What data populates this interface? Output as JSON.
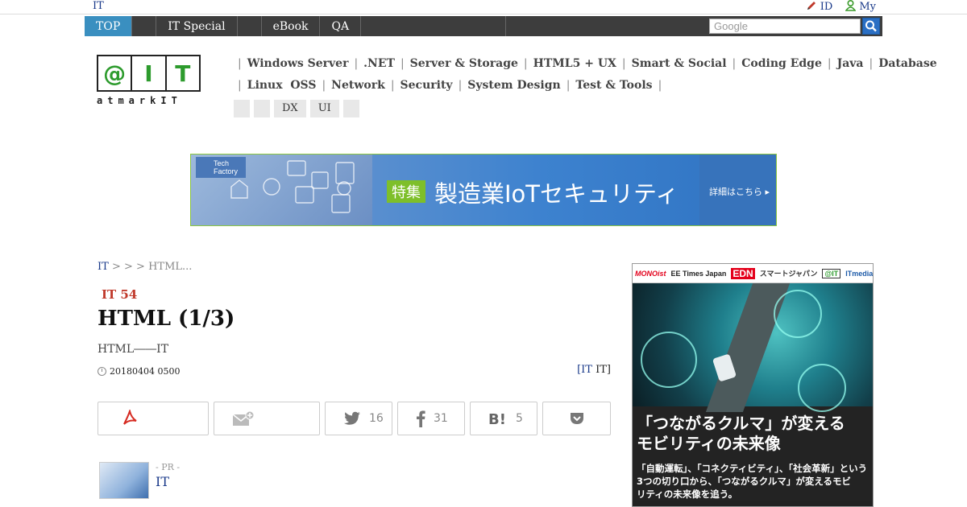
{
  "topbar": {
    "site_label": "IT",
    "id_label": "ID",
    "my_label": "My"
  },
  "nav": {
    "items": [
      {
        "label": "TOP",
        "active": true
      },
      {
        "label": ""
      },
      {
        "label": "IT Special"
      },
      {
        "label": ""
      },
      {
        "label": "eBook"
      },
      {
        "label": "QA"
      },
      {
        "label": ""
      }
    ],
    "search_placeholder": "Google"
  },
  "logo": {
    "letters": [
      "@",
      "I",
      "T"
    ],
    "wordmark": "atmarkIT"
  },
  "categories": {
    "row1": [
      "Windows Server",
      ".NET",
      "Server & Storage",
      "HTML5 + UX",
      "Smart & Social",
      "Coding Edge",
      "Java",
      "Database"
    ],
    "row2": [
      "Linux  OSS",
      "Network",
      "Security",
      "System Design",
      "Test & Tools"
    ],
    "chips": [
      "",
      "",
      "DX",
      "UI",
      ""
    ]
  },
  "banner": {
    "badge": "Tech Factory",
    "tag": "特集",
    "title": "製造業IoTセキュリティ",
    "more": "詳細はこちら ▸"
  },
  "article": {
    "breadcrumb": [
      "IT",
      ">",
      ">",
      "> HTML..."
    ],
    "series": "IT 54",
    "title": "HTML (1/3)",
    "subtitle": "HTML――IT",
    "date": "20180404 0500",
    "author_link": "[IT",
    "author_rest": "IT]"
  },
  "share": {
    "twitter_count": "16",
    "facebook_count": "31",
    "hatena_count": "5"
  },
  "pr": {
    "tag": "- PR -",
    "title": "IT"
  },
  "sidead": {
    "logos": [
      "MONOist",
      "EE Times Japan",
      "EDN",
      "スマートジャパン",
      "@IT",
      "ITmedia エンタープライズ"
    ],
    "headline_1": "「つながるクルマ」が変える",
    "headline_2": "モビリティの未来像",
    "body_1": "「自動運転」、「コネクティビティ」、「社会革新」という",
    "body_2": "3つの切り口から、「つながるクルマ」が変えるモビ",
    "body_3": "リティの未来像を追う。"
  },
  "colors": {
    "nav_bg": "#3d3d3d",
    "nav_active": "#3a8fc0",
    "accent_green": "#2d9b2d",
    "series_red": "#c0392b",
    "link_blue": "#1a3a8a"
  }
}
